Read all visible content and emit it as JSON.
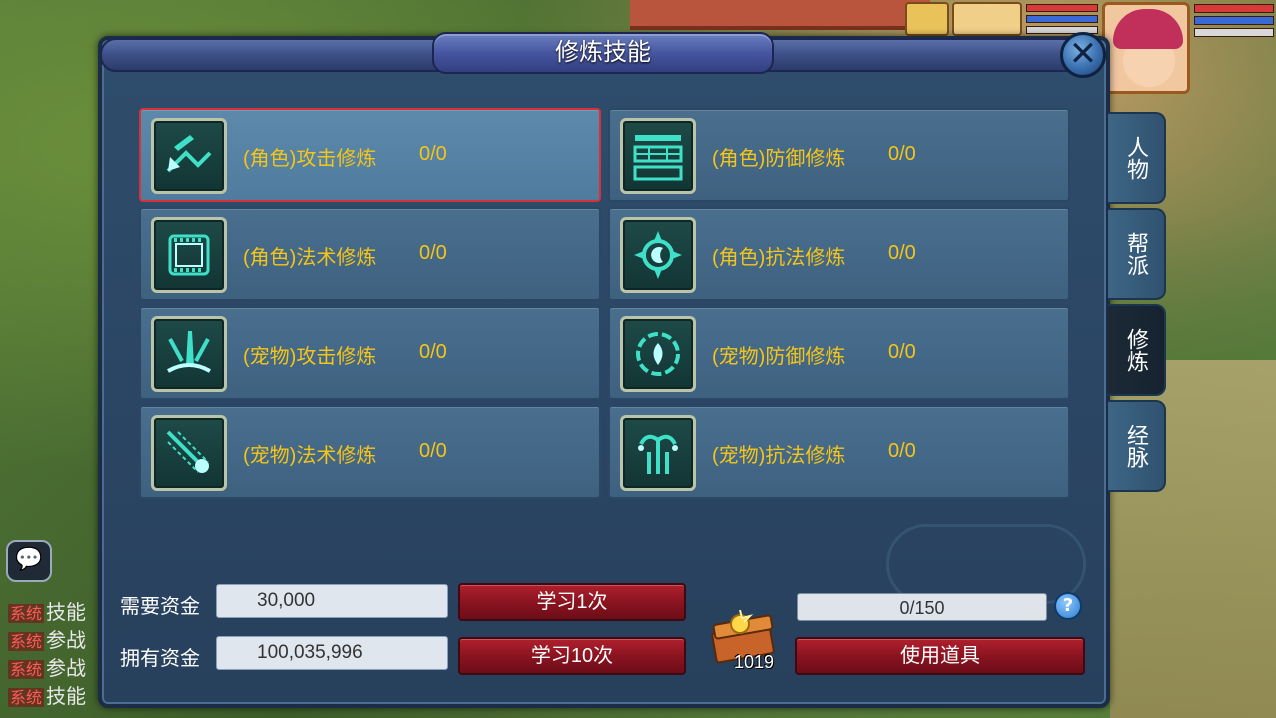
{
  "window": {
    "title": "修炼技能",
    "close_label": "✕"
  },
  "skills": [
    {
      "name": "(角色)攻击修炼",
      "level": "0/0",
      "selected": true,
      "icon": "sword-shield-icon"
    },
    {
      "name": "(角色)防御修炼",
      "level": "0/0",
      "selected": false,
      "icon": "wall-icon"
    },
    {
      "name": "(角色)法术修炼",
      "level": "0/0",
      "selected": false,
      "icon": "scroll-icon"
    },
    {
      "name": "(角色)抗法修炼",
      "level": "0/0",
      "selected": false,
      "icon": "sun-moon-icon"
    },
    {
      "name": "(宠物)攻击修炼",
      "level": "0/0",
      "selected": false,
      "icon": "claw-icon"
    },
    {
      "name": "(宠物)防御修炼",
      "level": "0/0",
      "selected": false,
      "icon": "flame-ring-icon"
    },
    {
      "name": "(宠物)法术修炼",
      "level": "0/0",
      "selected": false,
      "icon": "comet-icon"
    },
    {
      "name": "(宠物)抗法修炼",
      "level": "0/0",
      "selected": false,
      "icon": "fountain-icon"
    }
  ],
  "tabs": [
    {
      "label": "人物",
      "active": false
    },
    {
      "label": "帮派",
      "active": false
    },
    {
      "label": "修炼",
      "active": true
    },
    {
      "label": "经脉",
      "active": false
    }
  ],
  "funds": {
    "required_label": "需要资金",
    "required_value": "30,000",
    "owned_label": "拥有资金",
    "owned_value": "100,035,996"
  },
  "buttons": {
    "learn_once": "学习1次",
    "learn_ten": "学习10次",
    "use_item": "使用道具"
  },
  "progress": {
    "text": "0/150",
    "fraction": 0
  },
  "item": {
    "count": "1019",
    "icon": "treasure-chest-icon"
  },
  "help_label": "?",
  "chat": {
    "lines": [
      {
        "tag": "系统",
        "text": "技能"
      },
      {
        "tag": "系统",
        "text": "参战"
      },
      {
        "tag": "系统",
        "text": "参战"
      },
      {
        "tag": "系统",
        "text": "技能"
      }
    ]
  }
}
